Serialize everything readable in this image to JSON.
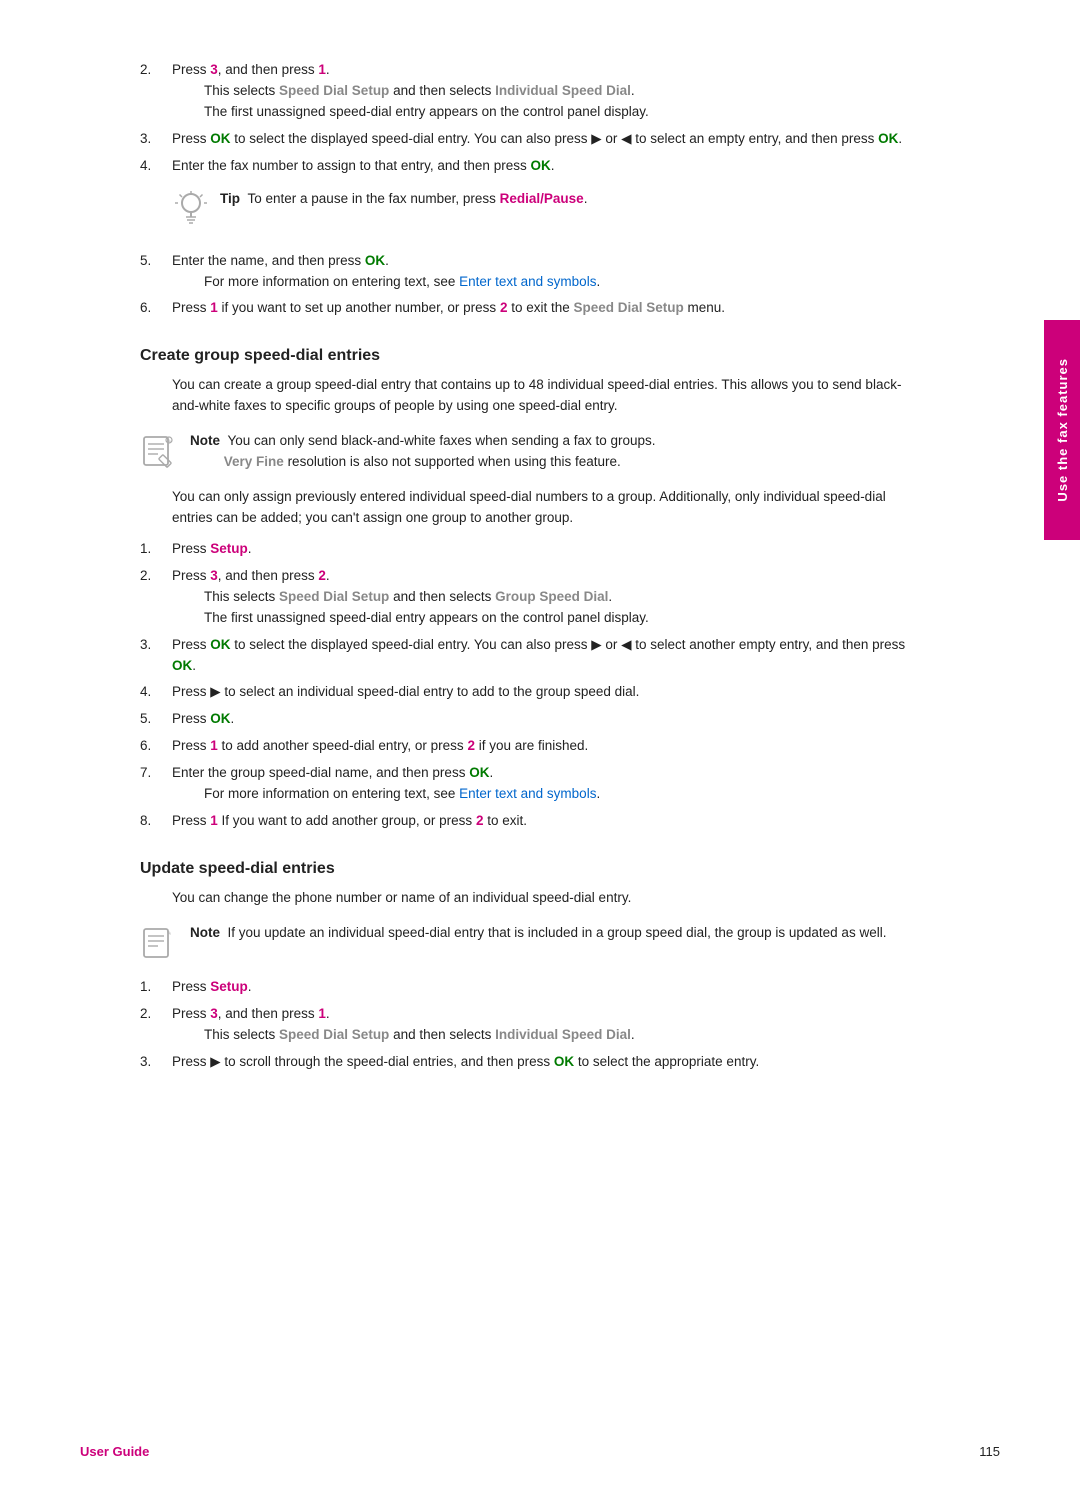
{
  "footer": {
    "left": "User Guide",
    "right": "115"
  },
  "side_tab": "Use the fax features",
  "intro_steps": [
    {
      "num": "2.",
      "main": "Press {3}, and then press {1}.",
      "sub1": "This selects {Speed Dial Setup} and then selects {Individual Speed Dial}.",
      "sub2": "The first unassigned speed-dial entry appears on the control panel display."
    },
    {
      "num": "3.",
      "main": "Press {OK} to select the displayed speed-dial entry. You can also press ▶ or ◀ to select an empty entry, and then press {OK}."
    },
    {
      "num": "4.",
      "main": "Enter the fax number to assign to that entry, and then press {OK}."
    }
  ],
  "tip": {
    "label": "Tip",
    "text": "To enter a pause in the fax number, press {Redial/Pause}."
  },
  "intro_steps2": [
    {
      "num": "5.",
      "main": "Enter the name, and then press {OK}.",
      "sub": "For more information on entering text, see {Enter text and symbols}."
    },
    {
      "num": "6.",
      "main": "Press {1} if you want to set up another number, or press {2} to exit the {Speed Dial Setup} menu."
    }
  ],
  "section1": {
    "heading": "Create group speed-dial entries",
    "intro": "You can create a group speed-dial entry that contains up to 48 individual speed-dial entries. This allows you to send black-and-white faxes to specific groups of people by using one speed-dial entry.",
    "note": {
      "label": "Note",
      "text1": "You can only send black-and-white faxes when sending a fax to groups.",
      "text2": "{Very Fine} resolution is also not supported when using this feature."
    },
    "para2": "You can only assign previously entered individual speed-dial numbers to a group. Additionally, only individual speed-dial entries can be added; you can't assign one group to another group.",
    "steps": [
      {
        "num": "1.",
        "main": "Press {Setup}."
      },
      {
        "num": "2.",
        "main": "Press {3}, and then press {2}.",
        "sub1": "This selects {Speed Dial Setup} and then selects {Group Speed Dial}.",
        "sub2": "The first unassigned speed-dial entry appears on the control panel display."
      },
      {
        "num": "3.",
        "main": "Press {OK} to select the displayed speed-dial entry. You can also press ▶ or ◀ to select another empty entry, and then press {OK}."
      },
      {
        "num": "4.",
        "main": "Press ▶ to select an individual speed-dial entry to add to the group speed dial."
      },
      {
        "num": "5.",
        "main": "Press {OK}."
      },
      {
        "num": "6.",
        "main": "Press {1} to add another speed-dial entry, or press {2} if you are finished."
      },
      {
        "num": "7.",
        "main": "Enter the group speed-dial name, and then press {OK}.",
        "sub": "For more information on entering text, see {Enter text and symbols}."
      },
      {
        "num": "8.",
        "main": "Press {1} If you want to add another group, or press {2} to exit."
      }
    ]
  },
  "section2": {
    "heading": "Update speed-dial entries",
    "intro": "You can change the phone number or name of an individual speed-dial entry.",
    "note": {
      "label": "Note",
      "text1": "If you update an individual speed-dial entry that is included in a group speed dial, the group is updated as well."
    },
    "steps": [
      {
        "num": "1.",
        "main": "Press {Setup}."
      },
      {
        "num": "2.",
        "main": "Press {3}, and then press {1}.",
        "sub1": "This selects {Speed Dial Setup} and then selects {Individual Speed Dial}."
      },
      {
        "num": "3.",
        "main": "Press ▶ to scroll through the speed-dial entries, and then press {OK} to select the appropriate entry."
      }
    ]
  }
}
